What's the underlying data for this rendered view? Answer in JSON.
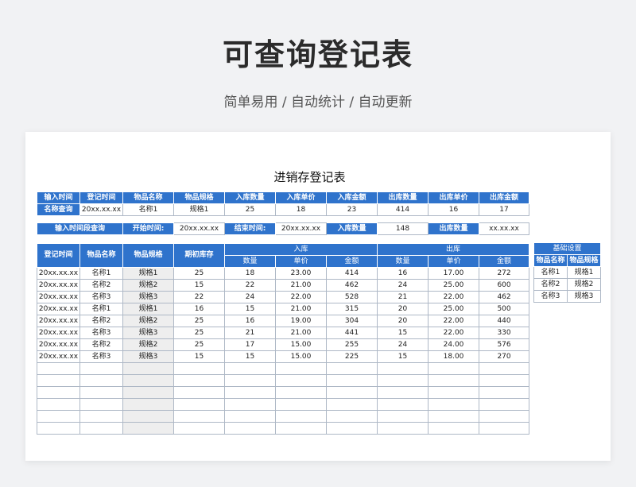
{
  "header": {
    "title": "可查询登记表",
    "subtitle": "简单易用 / 自动统计 / 自动更新"
  },
  "sheet": {
    "title": "进销存登记表",
    "summary": {
      "row_labels": [
        "输入时间",
        "名称查询"
      ],
      "headers": [
        "登记时间",
        "物品名称",
        "物品规格",
        "入库数量",
        "入库单价",
        "入库金额",
        "出库数量",
        "出库单价",
        "出库金额"
      ],
      "values": [
        "20xx.xx.xx",
        "名称1",
        "规格1",
        "25",
        "18",
        "23",
        "414",
        "16",
        "17"
      ]
    },
    "range_query": {
      "label": "输入时间段查询",
      "start_label": "开始时间:",
      "start_value": "20xx.xx.xx",
      "end_label": "结束时间:",
      "end_value": "20xx.xx.xx",
      "in_qty_label": "入库数量",
      "in_qty_value": "148",
      "out_qty_label": "出库数量",
      "out_qty_value": "xx.xx.xx"
    },
    "main_table": {
      "headers": {
        "date": "登记时间",
        "name": "物品名称",
        "spec": "物品规格",
        "opening": "期初库存",
        "in_group": "入库",
        "out_group": "出库",
        "qty": "数量",
        "price": "单价",
        "amount": "金额"
      },
      "rows": [
        [
          "20xx.xx.xx",
          "名称1",
          "规格1",
          "25",
          "18",
          "23.00",
          "414",
          "16",
          "17.00",
          "272"
        ],
        [
          "20xx.xx.xx",
          "名称2",
          "规格2",
          "15",
          "22",
          "21.00",
          "462",
          "24",
          "25.00",
          "600"
        ],
        [
          "20xx.xx.xx",
          "名称3",
          "规格3",
          "22",
          "24",
          "22.00",
          "528",
          "21",
          "22.00",
          "462"
        ],
        [
          "20xx.xx.xx",
          "名称1",
          "规格1",
          "16",
          "15",
          "21.00",
          "315",
          "20",
          "25.00",
          "500"
        ],
        [
          "20xx.xx.xx",
          "名称2",
          "规格2",
          "25",
          "16",
          "19.00",
          "304",
          "20",
          "22.00",
          "440"
        ],
        [
          "20xx.xx.xx",
          "名称3",
          "规格3",
          "25",
          "21",
          "21.00",
          "441",
          "15",
          "22.00",
          "330"
        ],
        [
          "20xx.xx.xx",
          "名称2",
          "规格2",
          "25",
          "17",
          "15.00",
          "255",
          "24",
          "24.00",
          "576"
        ],
        [
          "20xx.xx.xx",
          "名称3",
          "规格3",
          "15",
          "15",
          "15.00",
          "225",
          "15",
          "18.00",
          "270"
        ]
      ],
      "empty_rows": 6
    },
    "settings": {
      "title": "基础设置",
      "headers": [
        "物品名称",
        "物品规格"
      ],
      "rows": [
        [
          "名称1",
          "规格1"
        ],
        [
          "名称2",
          "规格2"
        ],
        [
          "名称3",
          "规格3"
        ]
      ]
    }
  },
  "colors": {
    "header_blue": "#2f73cc",
    "grid": "#aeb8c6",
    "shade": "#eeeeee"
  }
}
